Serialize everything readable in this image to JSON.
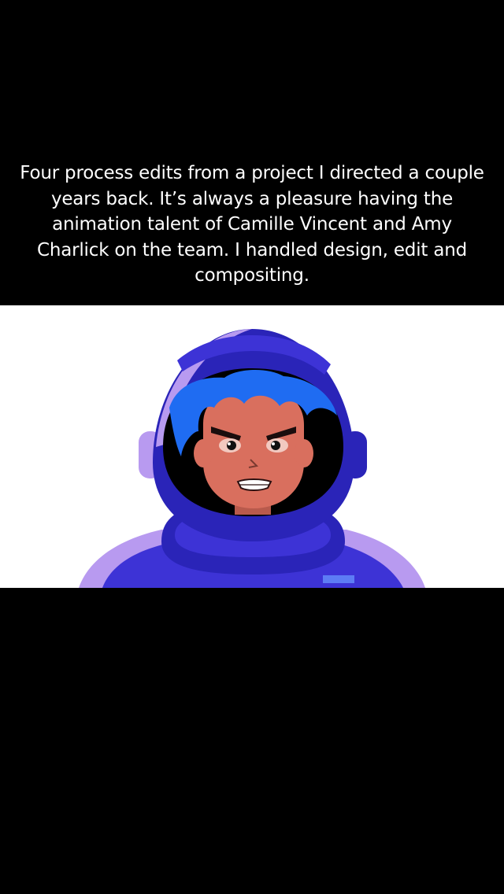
{
  "post": {
    "caption": "Four process edits from a project I directed a couple years back. It’s always a pleasure having the animation talent of Camille Vincent and Amy Charlick on the team. I handled design, edit and compositing."
  },
  "media": {
    "subject": "astronaut-character-illustration",
    "colors": {
      "background": "#ffffff",
      "suit_light": "#b89af0",
      "suit_dark": "#2a24b8",
      "suit_mid": "#3d33d6",
      "hair": "#1f6cf2",
      "skin": "#d96f5e",
      "visor": "#000000"
    }
  }
}
